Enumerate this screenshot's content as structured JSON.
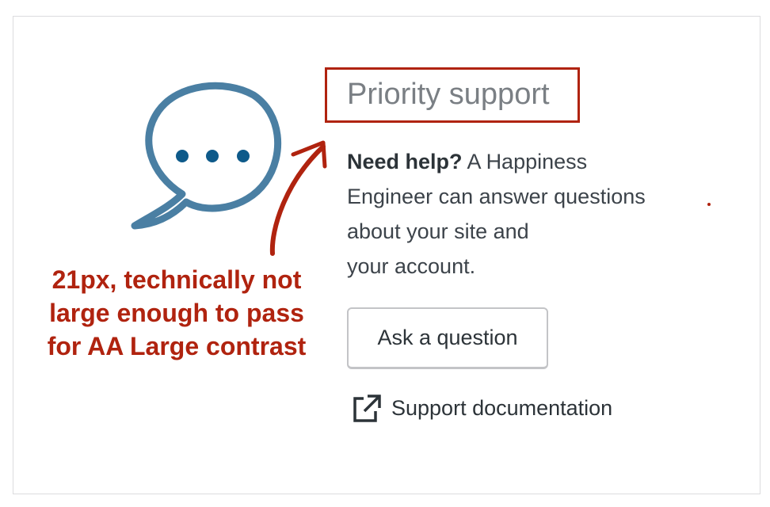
{
  "card": {
    "title": "Priority support",
    "description_bold": "Need help?",
    "description_line1_rest": " A Happiness",
    "description_line2": "Engineer can answer questions",
    "description_line3": "about your site and",
    "description_line4": "your account.",
    "ask_button_label": "Ask a question",
    "docs_link_label": "Support documentation"
  },
  "annotation": {
    "line1": "21px, technically not",
    "line2": "large enough to pass",
    "line3": "for AA Large contrast",
    "color": "#b0230f"
  },
  "icons": {
    "bubble": "chat-bubble-icon",
    "external": "external-link-icon"
  },
  "colors": {
    "bubble_outline": "#4a7fa3",
    "bubble_dots": "#0e5a8a",
    "title_text": "#7a7f84"
  }
}
